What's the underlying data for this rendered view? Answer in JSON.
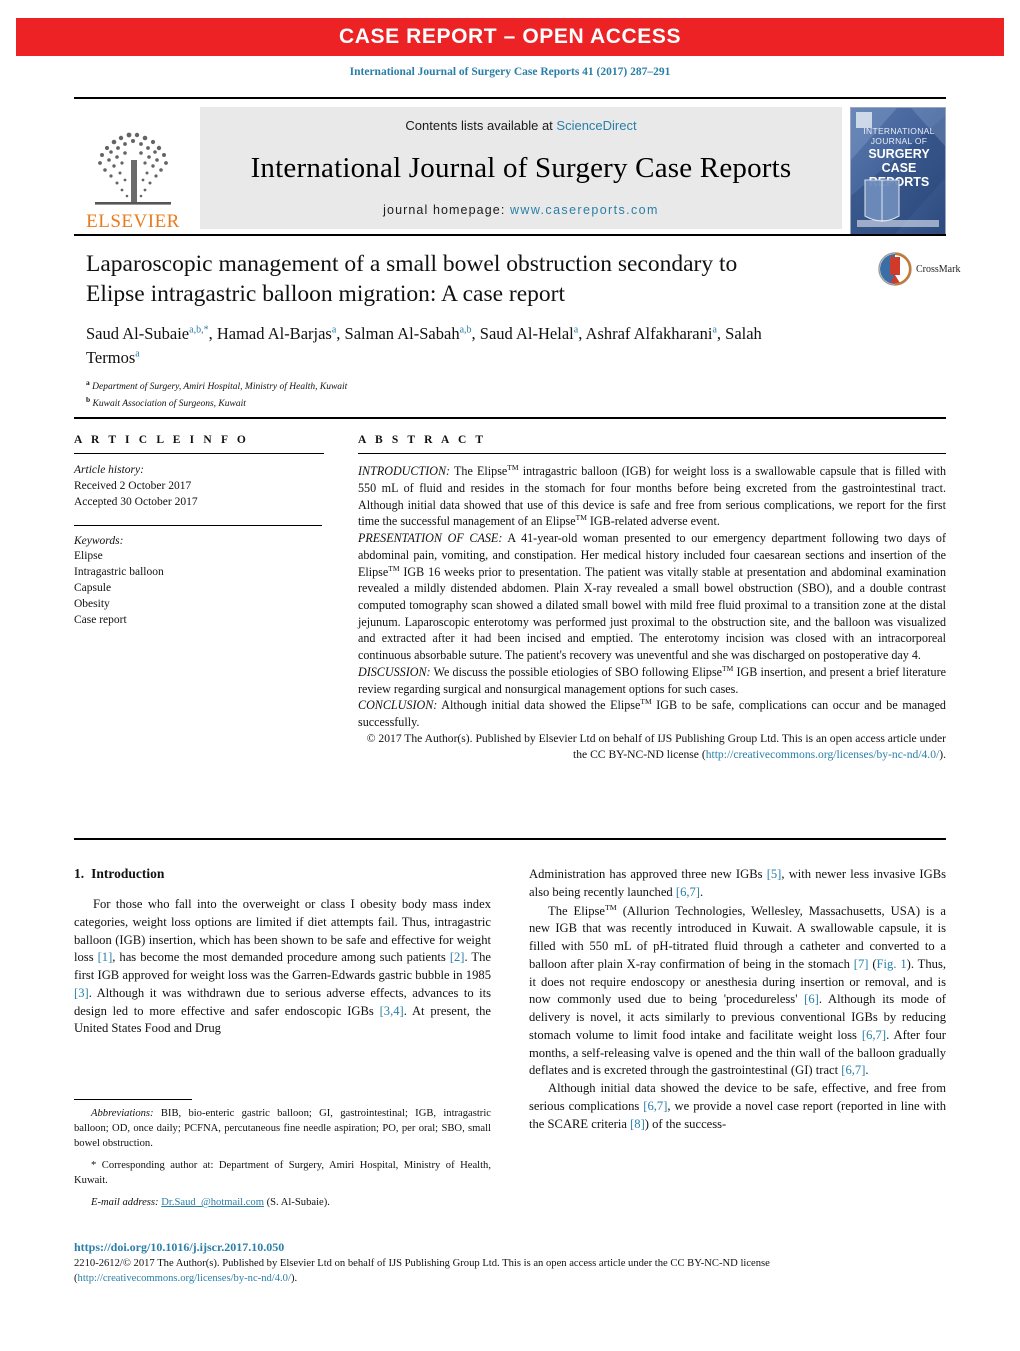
{
  "banner": {
    "label": "CASE REPORT – OPEN ACCESS",
    "background_color": "#ED2224",
    "text_color": "#FFFFFF"
  },
  "citation": "International Journal of Surgery Case Reports 41 (2017) 287–291",
  "masthead": {
    "publisher_logo_text": "ELSEVIER",
    "publisher_logo_color": "#E87B1E",
    "contents_prefix": "Contents lists available at ",
    "contents_link": "ScienceDirect",
    "journal_title": "International Journal of Surgery Case Reports",
    "homepage_prefix": "journal homepage: ",
    "homepage_url": "www.casereports.com",
    "link_color": "#2A7FA8",
    "cover_lines": [
      "INTERNATIONAL",
      "JOURNAL OF",
      "SURGERY",
      "CASE",
      "REPORTS"
    ]
  },
  "article": {
    "title": "Laparoscopic management of a small bowel obstruction secondary to Elipse intragastric balloon migration: A case report",
    "authors_html": "Saud Al-Subaie<sup>a,b,</sup><sup>*</sup>, Hamad Al-Barjas<sup>a</sup>, Salman Al-Sabah<sup>a,b</sup>, Saud Al-Helal<sup>a</sup>, Ashraf Alfakharani<sup>a</sup>, Salah Termos<sup>a</sup>",
    "affiliations": [
      {
        "marker": "a",
        "text": "Department of Surgery, Amiri Hospital, Ministry of Health, Kuwait"
      },
      {
        "marker": "b",
        "text": "Kuwait Association of Surgeons, Kuwait"
      }
    ],
    "crossmark_label": "CrossMark"
  },
  "article_info": {
    "heading": "A R T I C L E   I N F O",
    "history_label": "Article history:",
    "history": [
      "Received 2 October 2017",
      "Accepted 30 October 2017"
    ],
    "keywords_label": "Keywords:",
    "keywords": [
      "Elipse",
      "Intragastric balloon",
      "Capsule",
      "Obesity",
      "Case report"
    ]
  },
  "abstract": {
    "heading": "A B S T R A C T",
    "sections": [
      {
        "label": "INTRODUCTION:",
        "text": " The Elipse™ intragastric balloon (IGB) for weight loss is a swallowable capsule that is filled with 550 mL of fluid and resides in the stomach for four months before being excreted from the gastrointestinal tract. Although initial data showed that use of this device is safe and free from serious complications, we report for the first time the successful management of an Elipse™ IGB-related adverse event."
      },
      {
        "label": "PRESENTATION OF CASE:",
        "text": " A 41-year-old woman presented to our emergency department following two days of abdominal pain, vomiting, and constipation. Her medical history included four caesarean sections and insertion of the Elipse™ IGB 16 weeks prior to presentation. The patient was vitally stable at presentation and abdominal examination revealed a mildly distended abdomen. Plain X-ray revealed a small bowel obstruction (SBO), and a double contrast computed tomography scan showed a dilated small bowel with mild free fluid proximal to a transition zone at the distal jejunum. Laparoscopic enterotomy was performed just proximal to the obstruction site, and the balloon was visualized and extracted after it had been incised and emptied. The enterotomy incision was closed with an intracorporeal continuous absorbable suture. The patient's recovery was uneventful and she was discharged on postoperative day 4."
      },
      {
        "label": "DISCUSSION:",
        "text": " We discuss the possible etiologies of SBO following Elipse™ IGB insertion, and present a brief literature review regarding surgical and nonsurgical management options for such cases."
      },
      {
        "label": "CONCLUSION:",
        "text": " Although initial data showed the Elipse™ IGB to be safe, complications can occur and be managed successfully."
      }
    ],
    "copyright_text": "© 2017 The Author(s). Published by Elsevier Ltd on behalf of IJS Publishing Group Ltd. This is an open access article under the CC BY-NC-ND license (",
    "copyright_link": "http://creativecommons.org/licenses/by-nc-nd/4.0/",
    "copyright_tail": ")."
  },
  "body": {
    "section_number": "1.",
    "section_title": "Introduction",
    "left_paragraphs": [
      "For those who fall into the overweight or class I obesity body mass index categories, weight loss options are limited if diet attempts fail. Thus, intragastric balloon (IGB) insertion, which has been shown to be safe and effective for weight loss [1], has become the most demanded procedure among such patients [2]. The first IGB approved for weight loss was the Garren-Edwards gastric bubble in 1985 [3]. Although it was withdrawn due to serious adverse effects, advances to its design led to more effective and safer endoscopic IGBs [3,4]. At present, the United States Food and Drug"
    ],
    "right_paragraphs": [
      "Administration has approved three new IGBs [5], with newer less invasive IGBs also being recently launched [6,7].",
      "The Elipse™ (Allurion Technologies, Wellesley, Massachusetts, USA) is a new IGB that was recently introduced in Kuwait. A swallowable capsule, it is filled with 550 mL of pH-titrated fluid through a catheter and converted to a balloon after plain X-ray confirmation of being in the stomach [7] (Fig. 1). Thus, it does not require endoscopy or anesthesia during insertion or removal, and is now commonly used due to being 'procedureless' [6]. Although its mode of delivery is novel, it acts similarly to previous conventional IGBs by reducing stomach volume to limit food intake and facilitate weight loss [6,7]. After four months, a self-releasing valve is opened and the thin wall of the balloon gradually deflates and is excreted through the gastrointestinal (GI) tract [6,7].",
      "Although initial data showed the device to be safe, effective, and free from serious complications [6,7], we provide a novel case report (reported in line with the SCARE criteria [8]) of the success-"
    ]
  },
  "footnotes": {
    "abbrev_label": "Abbreviations:",
    "abbrev_text": "  BIB, bio-enteric gastric balloon; GI, gastrointestinal; IGB, intragastric balloon; OD, once daily; PCFNA, percutaneous fine needle aspiration; PO, per oral; SBO, small bowel obstruction.",
    "corresponding": "* Corresponding author at: Department of Surgery, Amiri Hospital, Ministry of Health, Kuwait.",
    "email_label": "E-mail address:",
    "email_link": "Dr.Saud_@hotmail.com",
    "email_tail": " (S. Al-Subaie)."
  },
  "footer": {
    "doi": "https://doi.org/10.1016/j.ijscr.2017.10.050",
    "issn_line": "2210-2612/© 2017 The Author(s). Published by Elsevier Ltd on behalf of IJS Publishing Group Ltd. This is an open access article under the CC BY-NC-ND license (",
    "license_link": "http://creativecommons.org/licenses/by-nc-nd/4.0/",
    "license_tail": ")."
  }
}
